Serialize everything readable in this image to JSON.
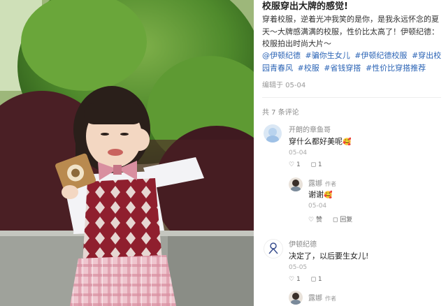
{
  "post": {
    "title": "校服穿出大牌的感觉!",
    "body": "穿着校服，逆着光冲我笑的是你，是我永远怀念的夏天～大牌感满满的校服，性价比太高了！伊顿纪德：校服拍出时尚大片～",
    "tags": [
      "@伊顿纪德",
      "#骗你生女儿",
      "#伊顿纪德校服",
      "#穿出校园青春风",
      "#校服",
      "#省钱穿搭",
      "#性价比穿搭推荐"
    ],
    "edited": "编辑于 05-04"
  },
  "comments_header": "共 7 条评论",
  "comments": [
    {
      "user": "开朗的章鱼哥",
      "text": "穿什么都好美呢",
      "emoji": "🥰",
      "date": "05-04",
      "likes": "1",
      "replies": "1",
      "reply": {
        "user": "露娜",
        "badge": "作者",
        "text": "谢谢",
        "emoji": "🥰",
        "date": "05-04",
        "like_label": "赞",
        "reply_label": "回复"
      }
    },
    {
      "user": "伊顿纪德",
      "avatar_text": "伊顿纪德",
      "text": "决定了，以后要生女儿!",
      "date": "05-05",
      "likes": "1",
      "replies": "1",
      "reply": {
        "user": "露娜",
        "badge": "作者"
      }
    }
  ],
  "icons": {
    "like": "heart-icon",
    "reply": "comment-bubble-icon"
  },
  "colors": {
    "tag_link": "#2a63b5",
    "vest": "#8f1f2e",
    "skirt": "#e9b9c2"
  }
}
